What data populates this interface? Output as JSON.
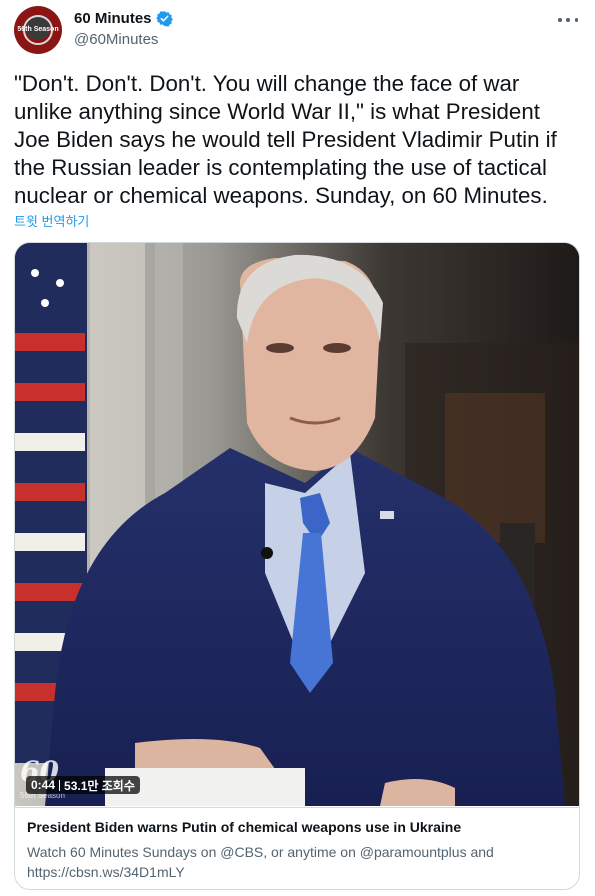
{
  "author": {
    "display_name": "60 Minutes",
    "handle": "@60Minutes",
    "avatar_label": "56th Season",
    "verified_color": "#1d9bf0"
  },
  "tweet": {
    "text": "\"Don't. Don't. Don't. You will change the face of war\nunlike anything since World War II,\" is what President\nJoe Biden says he would tell President Vladimir Putin if\nthe Russian leader is contemplating the use of tactical\nnuclear or chemical weapons. Sunday, on 60 Minutes.",
    "translate_label": "트윗 번역하기"
  },
  "media": {
    "duration": "0:44",
    "views": "53.1만 조회수",
    "watermark": "60",
    "season_tag": "56th Season"
  },
  "card": {
    "title": "President Biden warns Putin of chemical weapons use in Ukraine",
    "description": "Watch 60 Minutes Sundays on @CBS, or anytime on @paramountplus and\nhttps://cbsn.ws/34D1mLY"
  },
  "colors": {
    "link": "#1d9bf0",
    "secondary_text": "#536471",
    "border": "#cfd9de"
  }
}
